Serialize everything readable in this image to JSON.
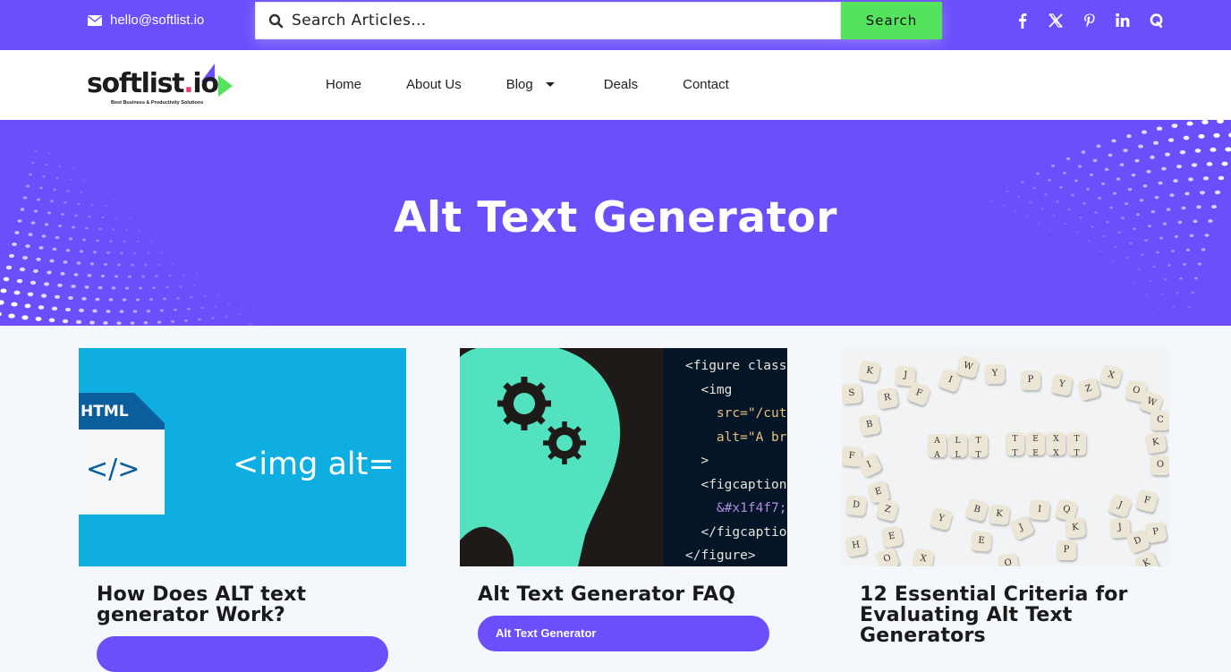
{
  "topbar": {
    "email": "hello@softlist.io",
    "search_placeholder": "Search Articles...",
    "search_button": "Search",
    "socials": [
      "facebook",
      "x",
      "pinterest",
      "linkedin",
      "quora"
    ]
  },
  "brand": {
    "name_main": "softlist",
    "name_dot": ".",
    "name_tld": "io",
    "tagline": "Best Business & Productivity Solutions",
    "colors": {
      "primary": "#6c4ffb",
      "accent_green": "#55e35e",
      "dot_pink": "#e8407a"
    }
  },
  "nav": {
    "items": [
      {
        "label": "Home"
      },
      {
        "label": "About Us"
      },
      {
        "label": "Blog",
        "has_dropdown": true
      },
      {
        "label": "Deals"
      },
      {
        "label": "Contact"
      }
    ]
  },
  "hero": {
    "title": "Alt Text Generator"
  },
  "cards": [
    {
      "title": "How Does ALT text generator Work?",
      "button": "",
      "image": {
        "doc_label": "HTML",
        "doc_symbol": "</>",
        "code_text": "<img alt="
      }
    },
    {
      "title": "Alt Text Generator FAQ",
      "button": "Alt Text Generator",
      "image": {
        "code_lines": [
          "<figure class",
          "  <img",
          "    src=\"/cut",
          "    alt=\"A br",
          "  >",
          "  <figcaption",
          "    &#x1f4f7;",
          "  </figcaptio",
          "</figure>"
        ]
      }
    },
    {
      "title": "12 Essential Criteria for Evaluating Alt Text Generators",
      "button": "",
      "image": {
        "word1": [
          "A",
          "L",
          "T"
        ],
        "word2": [
          "T",
          "E",
          "X",
          "T"
        ]
      }
    }
  ]
}
